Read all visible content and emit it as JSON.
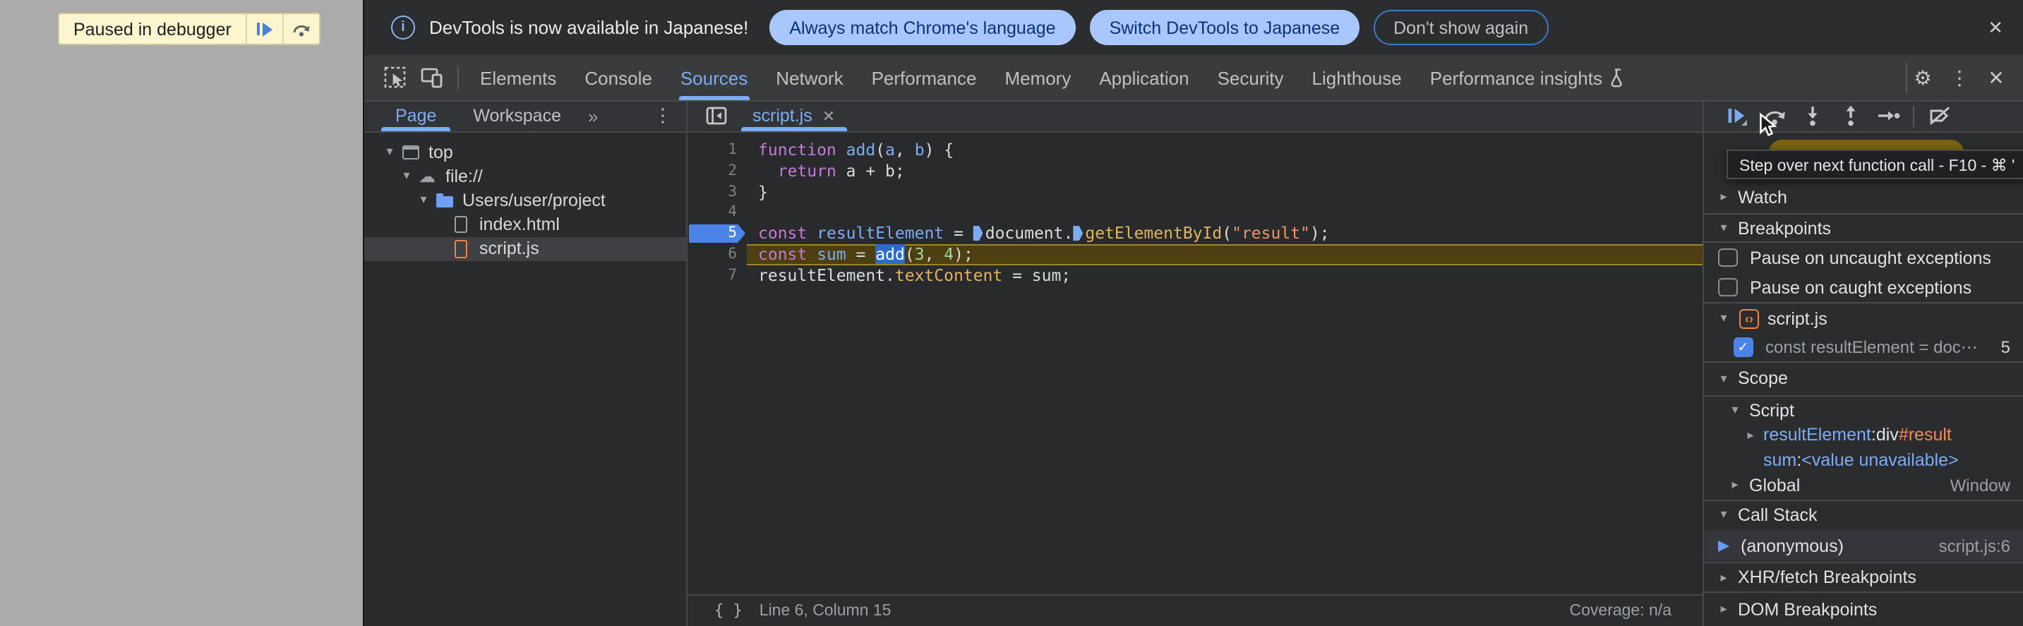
{
  "icons": {
    "gear": "⚙",
    "more": "⋮",
    "close": "✕",
    "chevron_double": "»",
    "check": "✓",
    "code_brackets": "‹›",
    "braces": "{ }",
    "cloud": "☁",
    "caret_down": "▾",
    "caret_right": "▸",
    "info": "i"
  },
  "page_overlay": {
    "paused_label": "Paused in debugger"
  },
  "notification": {
    "message": "DevTools is now available in Japanese!",
    "actions": [
      {
        "label": "Always match Chrome's language",
        "style": "filled"
      },
      {
        "label": "Switch DevTools to Japanese",
        "style": "filled"
      },
      {
        "label": "Don't show again",
        "style": "outline"
      }
    ]
  },
  "main_toolbar": {
    "tabs": [
      {
        "label": "Elements",
        "active": false
      },
      {
        "label": "Console",
        "active": false
      },
      {
        "label": "Sources",
        "active": true
      },
      {
        "label": "Network",
        "active": false
      },
      {
        "label": "Performance",
        "active": false
      },
      {
        "label": "Memory",
        "active": false
      },
      {
        "label": "Application",
        "active": false
      },
      {
        "label": "Security",
        "active": false
      },
      {
        "label": "Lighthouse",
        "active": false
      },
      {
        "label": "Performance insights",
        "active": false,
        "icon": "flask-icon"
      }
    ]
  },
  "navigator": {
    "tabs": [
      {
        "label": "Page",
        "active": true
      },
      {
        "label": "Workspace",
        "active": false
      }
    ],
    "overflow_chevron": "»",
    "tree": [
      {
        "label": "top",
        "icon": "frame",
        "level": 0,
        "expanded": true
      },
      {
        "label": "file://",
        "icon": "cloud",
        "level": 1,
        "expanded": true
      },
      {
        "label": "Users/user/project",
        "icon": "folder",
        "level": 2,
        "expanded": true
      },
      {
        "label": "index.html",
        "icon": "file-gray",
        "level": 3
      },
      {
        "label": "script.js",
        "icon": "file-orange",
        "level": 3,
        "selected": true
      }
    ]
  },
  "editor": {
    "tab_label": "script.js",
    "lines": [
      {
        "n": 1,
        "tokens": [
          [
            "kw",
            "function"
          ],
          [
            "pl",
            " "
          ],
          [
            "def",
            "add"
          ],
          [
            "pl",
            "("
          ],
          [
            "def",
            "a"
          ],
          [
            "pl",
            ", "
          ],
          [
            "def",
            "b"
          ],
          [
            "pl",
            ") {"
          ]
        ]
      },
      {
        "n": 2,
        "tokens": [
          [
            "pl",
            "  "
          ],
          [
            "kw",
            "return"
          ],
          [
            "pl",
            " a + b;"
          ]
        ]
      },
      {
        "n": 3,
        "tokens": [
          [
            "pl",
            "}"
          ]
        ]
      },
      {
        "n": 4,
        "tokens": []
      },
      {
        "n": 5,
        "breakpoint": true,
        "tokens": [
          [
            "kw",
            "const"
          ],
          [
            "pl",
            " "
          ],
          [
            "def",
            "resultElement"
          ],
          [
            "pl",
            " = "
          ],
          [
            "bp-marker",
            ""
          ],
          [
            "pl",
            "document."
          ],
          [
            "bp-marker",
            ""
          ],
          [
            "fn",
            "getElementById"
          ],
          [
            "pl",
            "("
          ],
          [
            "str",
            "\"result\""
          ],
          [
            "pl",
            ");"
          ]
        ]
      },
      {
        "n": 6,
        "paused": true,
        "tokens": [
          [
            "kw",
            "const"
          ],
          [
            "pl",
            " "
          ],
          [
            "def",
            "sum"
          ],
          [
            "pl",
            " = "
          ],
          [
            "sel",
            "add"
          ],
          [
            "pl",
            "("
          ],
          [
            "num",
            "3"
          ],
          [
            "pl",
            ", "
          ],
          [
            "num",
            "4"
          ],
          [
            "pl",
            ");"
          ]
        ]
      },
      {
        "n": 7,
        "tokens": [
          [
            "pl",
            "resultElement."
          ],
          [
            "fn",
            "textContent"
          ],
          [
            "pl",
            " = sum;"
          ]
        ]
      }
    ],
    "status": {
      "position": "Line 6, Column 15",
      "coverage": "Coverage: n/a"
    }
  },
  "debugger": {
    "tooltip": "Step over next function call - F10 - ⌘ '",
    "watch_label": "Watch",
    "breakpoints_label": "Breakpoints",
    "pause_uncaught": "Pause on uncaught exceptions",
    "pause_caught": "Pause on caught exceptions",
    "bp_group": {
      "file": "script.js",
      "entry_text": "const resultElement = doc⋯",
      "entry_line": "5"
    },
    "scope": {
      "label": "Scope",
      "script_label": "Script",
      "var1_name": "resultElement",
      "var1_sep": ": ",
      "var1_value_tag": "div",
      "var1_value_id": "#result",
      "var2_name": "sum",
      "var2_sep": ": ",
      "var2_value": "<value unavailable>",
      "global_label": "Global",
      "global_value": "Window"
    },
    "call_stack": {
      "label": "Call Stack",
      "frame": "(anonymous)",
      "location": "script.js:6"
    },
    "xhr_label": "XHR/fetch Breakpoints",
    "dom_label": "DOM Breakpoints"
  }
}
